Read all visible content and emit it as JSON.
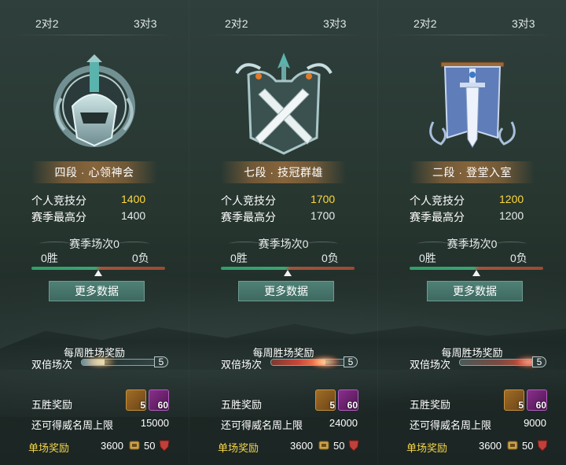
{
  "panels": [
    {
      "tabs": [
        "2对2",
        "3对3"
      ],
      "emblem": "ghost-helm-emblem",
      "rank_name": "四段 · 心领神会",
      "stats": [
        {
          "label": "个人竞技分",
          "value": "1400"
        },
        {
          "label": "赛季最高分",
          "value": "1400"
        }
      ],
      "season_matches": "赛季场次0",
      "wins": "0胜",
      "losses": "0负",
      "more_button": "更多数据",
      "weekly_title": "每周胜场奖励",
      "double_label": "双倍场次",
      "double_value": "5",
      "double_progress": 0.3,
      "five_win_label": "五胜奖励",
      "reward_items": [
        {
          "name": "treasure-chest-icon",
          "count": "5"
        },
        {
          "name": "purple-potion-icon",
          "count": "60"
        }
      ],
      "cap_label": "还可得威名周上限",
      "cap_value": "15000",
      "single_label": "单场奖励",
      "single_coins": "3600",
      "single_honor": "50"
    },
    {
      "tabs": [
        "2对2",
        "3对3"
      ],
      "emblem": "crossed-swords-emblem",
      "rank_name": "七段 · 技冠群雄",
      "stats": [
        {
          "label": "个人竞技分",
          "value": "1700"
        },
        {
          "label": "赛季最高分",
          "value": "1700"
        }
      ],
      "season_matches": "赛季场次0",
      "wins": "0胜",
      "losses": "0负",
      "more_button": "更多数据",
      "weekly_title": "每周胜场奖励",
      "double_label": "双倍场次",
      "double_value": "5",
      "double_progress": 0.7,
      "five_win_label": "五胜奖励",
      "reward_items": [
        {
          "name": "treasure-chest-icon",
          "count": "5"
        },
        {
          "name": "purple-potion-icon",
          "count": "60"
        }
      ],
      "cap_label": "还可得威名周上限",
      "cap_value": "24000",
      "single_label": "单场奖励",
      "single_coins": "3600",
      "single_honor": "50"
    },
    {
      "tabs": [
        "2对2",
        "3对3"
      ],
      "emblem": "banner-sword-emblem",
      "rank_name": "二段 · 登堂入室",
      "stats": [
        {
          "label": "个人竞技分",
          "value": "1200"
        },
        {
          "label": "赛季最高分",
          "value": "1200"
        }
      ],
      "season_matches": "赛季场次0",
      "wins": "0胜",
      "losses": "0负",
      "more_button": "更多数据",
      "weekly_title": "每周胜场奖励",
      "double_label": "双倍场次",
      "double_value": "5",
      "double_progress": 1.0,
      "five_win_label": "五胜奖励",
      "reward_items": [
        {
          "name": "treasure-chest-icon",
          "count": "5"
        },
        {
          "name": "purple-potion-icon",
          "count": "60"
        }
      ],
      "cap_label": "还可得威名周上限",
      "cap_value": "9000",
      "single_label": "单场奖励",
      "single_coins": "3600",
      "single_honor": "50"
    }
  ],
  "colors": {
    "score_gold": "#ffd83a",
    "single_reward_label": "#f5d64a",
    "win_bar": "#2fa06a",
    "loss_bar": "#a3523a",
    "button": "#4f8076"
  }
}
